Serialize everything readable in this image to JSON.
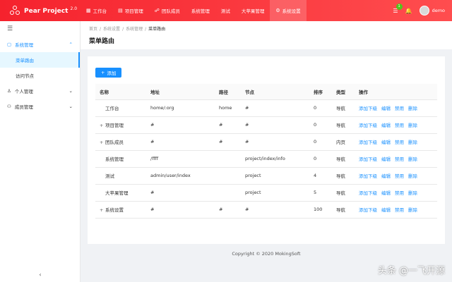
{
  "app": {
    "name": "Pear Project",
    "version": "2.0"
  },
  "nav": [
    {
      "icon": "home-icon",
      "glyph": "▦",
      "label": "工作台"
    },
    {
      "icon": "project-icon",
      "glyph": "▤",
      "label": "项目管理"
    },
    {
      "icon": "team-icon",
      "glyph": "☍",
      "label": "团队成员"
    },
    {
      "icon": "",
      "glyph": "",
      "label": "系统管理"
    },
    {
      "icon": "",
      "glyph": "",
      "label": "测试"
    },
    {
      "icon": "",
      "glyph": "",
      "label": "大苹果管理"
    },
    {
      "icon": "gear-icon",
      "glyph": "⚙",
      "label": "系统设置"
    }
  ],
  "topright": {
    "task_badge": "1",
    "username": "demo"
  },
  "sidebar": {
    "groups": [
      {
        "label": "系统管理",
        "open": true,
        "icon": "system-icon",
        "glyph": "▢",
        "children": [
          "菜单路由",
          "访问节点"
        ]
      },
      {
        "label": "个人管理",
        "open": false,
        "icon": "user-icon",
        "glyph": "♙",
        "children": []
      },
      {
        "label": "成员管理",
        "open": false,
        "icon": "members-icon",
        "glyph": "⚇",
        "children": []
      }
    ],
    "active_item": "菜单路由"
  },
  "breadcrumb": [
    "首页",
    "系统设置",
    "系统管理",
    "菜单路由"
  ],
  "page_title": "菜单路由",
  "add_button": "添加",
  "table": {
    "headers": [
      "名称",
      "地址",
      "路径",
      "节点",
      "排序",
      "类型",
      "操作"
    ],
    "actions": [
      "添加下级",
      "编辑",
      "禁用",
      "删除"
    ],
    "rows": [
      {
        "expand": false,
        "name": "工作台",
        "address": "home/:org",
        "path": "home",
        "node": "#",
        "sort": "0",
        "type": "导航"
      },
      {
        "expand": true,
        "name": "项目管理",
        "address": "#",
        "path": "#",
        "node": "#",
        "sort": "0",
        "type": "导航"
      },
      {
        "expand": true,
        "name": "团队成员",
        "address": "#",
        "path": "#",
        "node": "#",
        "sort": "0",
        "type": "内页"
      },
      {
        "expand": false,
        "name": "系统管理",
        "address": "/ffff",
        "path": "",
        "node": "project/index/info",
        "sort": "0",
        "type": "导航"
      },
      {
        "expand": false,
        "name": "测试",
        "address": "admin/user/index",
        "path": "",
        "node": "project",
        "sort": "4",
        "type": "导航"
      },
      {
        "expand": false,
        "name": "大苹果管理",
        "address": "#",
        "path": "",
        "node": "project",
        "sort": "5",
        "type": "导航"
      },
      {
        "expand": true,
        "name": "系统设置",
        "address": "#",
        "path": "#",
        "node": "#",
        "sort": "100",
        "type": "导航"
      }
    ]
  },
  "footer": "Copyright © 2020 MokingSoft",
  "watermark": "头条 @一飞开源",
  "colors": {
    "brand": "#f5222d",
    "accent": "#1890ff"
  }
}
